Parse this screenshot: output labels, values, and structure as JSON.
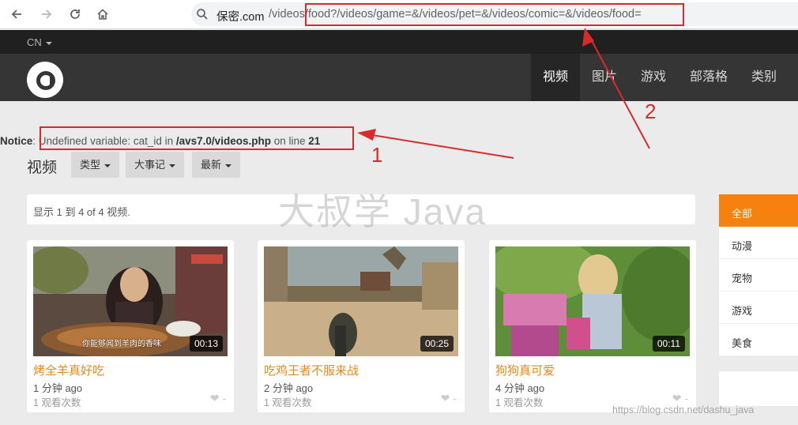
{
  "browser": {
    "address_host": "保密.com",
    "address_path": "/videos/food?/videos/game=&/videos/pet=&/videos/comic=&/videos/food="
  },
  "site": {
    "language": "CN",
    "nav": [
      {
        "label": "视频",
        "active": true
      },
      {
        "label": "图片",
        "active": false
      },
      {
        "label": "游戏",
        "active": false
      },
      {
        "label": "部落格",
        "active": false
      },
      {
        "label": "类别",
        "active": false
      }
    ]
  },
  "notice": {
    "label": "Notice",
    "message": ": Undefined variable: cat_id in ",
    "file": "/avs7.0/videos.php",
    "on_line": " on line ",
    "line": "21"
  },
  "page": {
    "title": "视频",
    "filters": [
      "类型",
      "大事记",
      "最新"
    ],
    "count_text": "显示 1 到 4 of 4 视频.",
    "watermark": "大叔学 Java"
  },
  "videos": [
    {
      "title": "烤全羊真好吃",
      "duration": "00:13",
      "time": "1 分钟 ago",
      "views": "1 观看次数",
      "likes": "-",
      "subtitle": "你能够闻到羊肉的香味"
    },
    {
      "title": "吃鸡王者不服来战",
      "duration": "00:25",
      "time": "2 分钟 ago",
      "views": "1 观看次数",
      "likes": "-"
    },
    {
      "title": "狗狗真可爱",
      "duration": "00:11",
      "time": "4 分钟 ago",
      "views": "1 观看次数",
      "likes": "-"
    }
  ],
  "sidebar": {
    "items": [
      {
        "label": "全部",
        "active": true
      },
      {
        "label": "动漫"
      },
      {
        "label": "宠物"
      },
      {
        "label": "游戏"
      },
      {
        "label": "美食"
      }
    ]
  },
  "annotations": {
    "label1": "1",
    "label2": "2",
    "color": "#d92b2b"
  },
  "footer_watermark": "https://blog.csdn.net/dashu_java",
  "colors": {
    "accent": "#f7810f",
    "title": "#e8891a",
    "header": "#353535"
  }
}
